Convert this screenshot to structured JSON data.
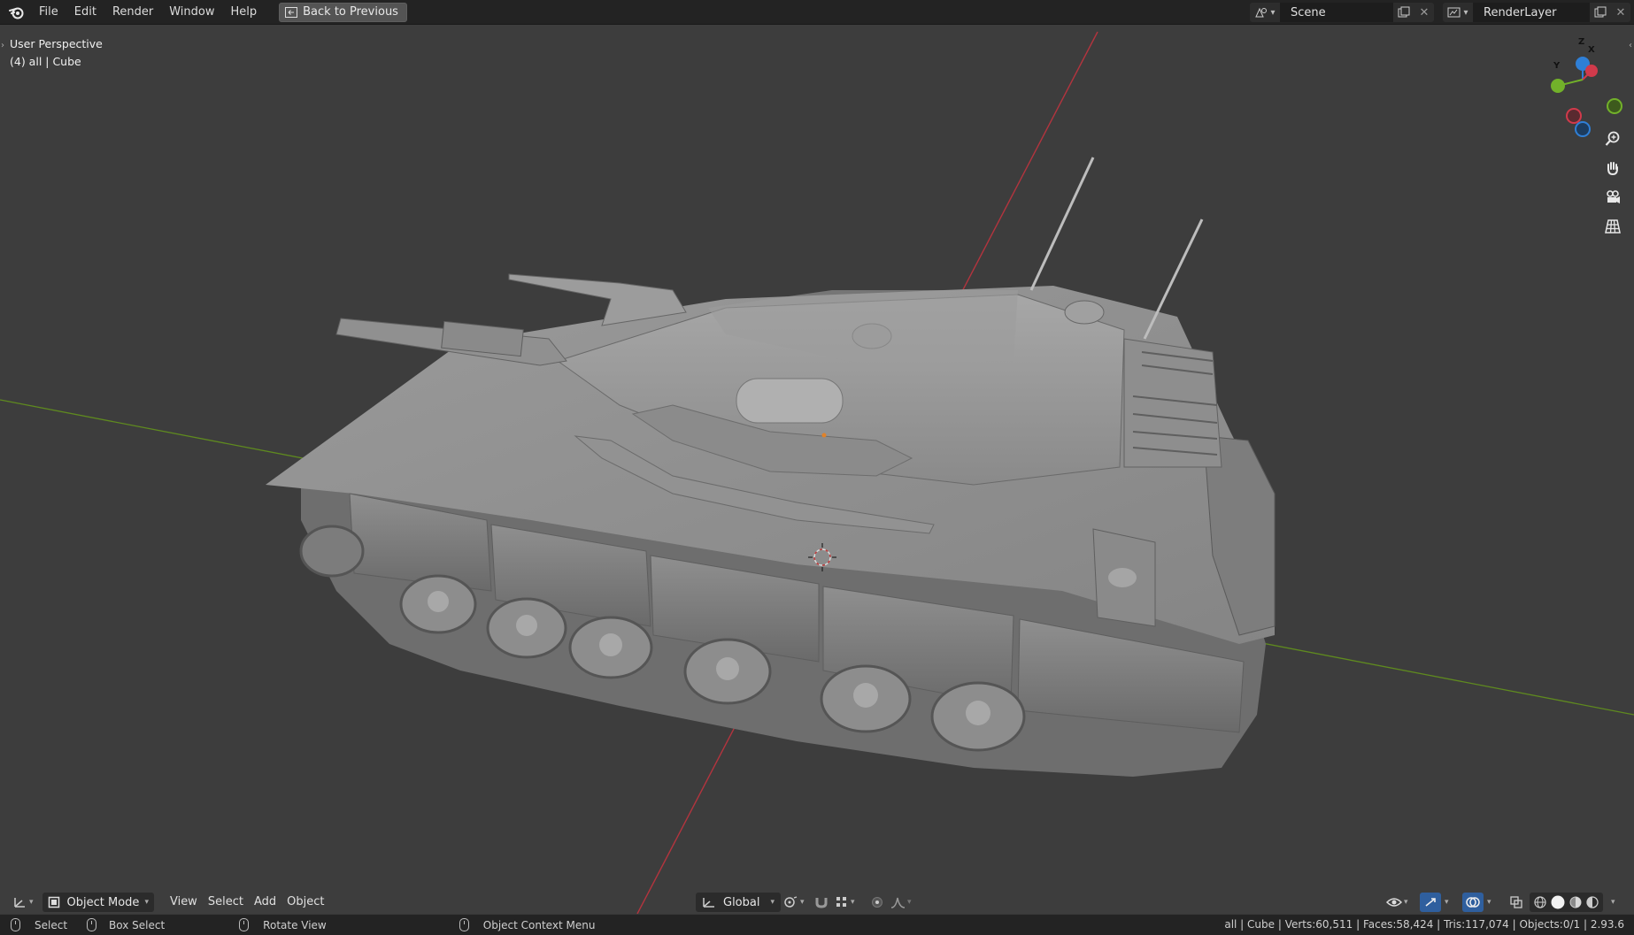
{
  "topbar": {
    "menu": [
      "File",
      "Edit",
      "Render",
      "Window",
      "Help"
    ],
    "back_label": "Back to Previous",
    "scene_label": "Scene",
    "renderlayer_label": "RenderLayer"
  },
  "viewport": {
    "perspective_label": "User Perspective",
    "collection_label": "(4) all | Cube",
    "gizmo_axes": [
      "Z",
      "X",
      "Y"
    ],
    "axis_colors": {
      "x": "#d13a4b",
      "y": "#72b12a",
      "z": "#2f7fd6"
    }
  },
  "header": {
    "mode_label": "Object Mode",
    "menu": [
      "View",
      "Select",
      "Add",
      "Object"
    ],
    "transform_orientation": "Global"
  },
  "status": {
    "hints": [
      "Select",
      "Box Select",
      "Rotate View",
      "Object Context Menu"
    ],
    "stats": "all | Cube | Verts:60,511 | Faces:58,424 | Tris:117,074 | Objects:0/1 | 2.93.6"
  }
}
